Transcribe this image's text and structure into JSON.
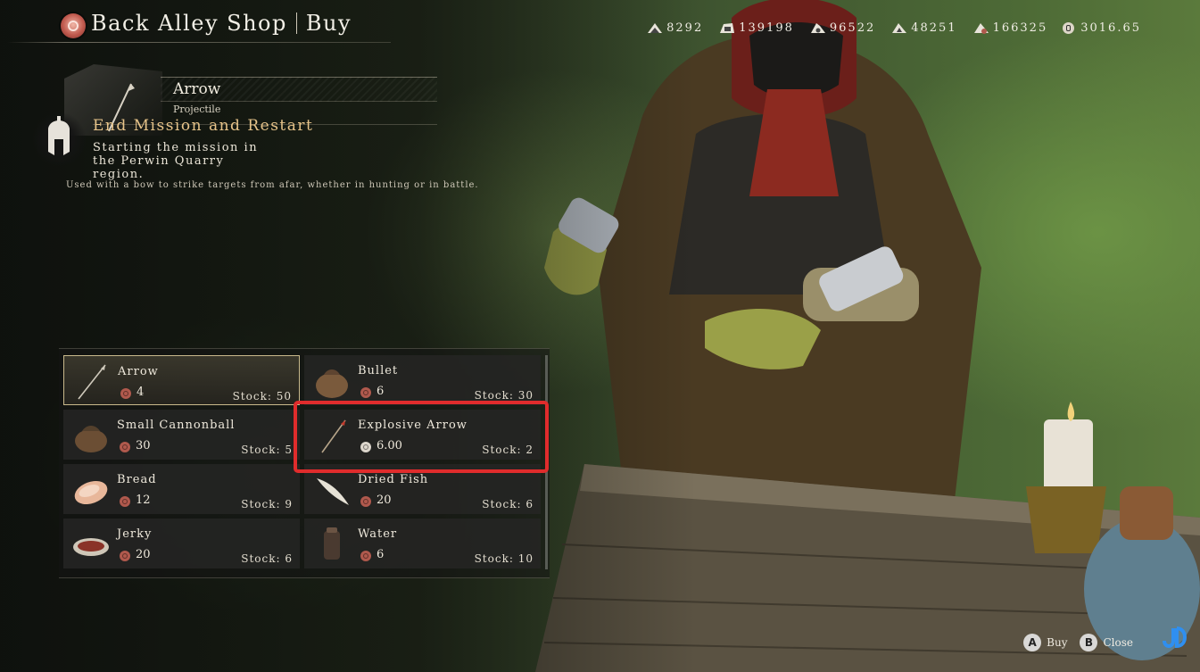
{
  "header": {
    "shop_name": "Back Alley Shop",
    "mode": "Buy"
  },
  "resources": [
    {
      "icon": "wood-resource-icon",
      "value": "8292"
    },
    {
      "icon": "iron-resource-icon",
      "value": "139198"
    },
    {
      "icon": "stone-resource-icon",
      "value": "96522"
    },
    {
      "icon": "leather-resource-icon",
      "value": "48251"
    },
    {
      "icon": "food-resource-icon",
      "value": "166325"
    },
    {
      "icon": "silver-coin-icon",
      "value": "3016.65"
    }
  ],
  "item_info": {
    "name": "Arrow",
    "category": "Projectile",
    "description": "Used with a bow to strike targets from afar, whether in hunting or in battle."
  },
  "mission": {
    "title": "End Mission and Restart",
    "description": "Starting the mission in the Perwin Quarry region."
  },
  "shop_items": [
    {
      "name": "Arrow",
      "price": "4",
      "stock_label": "Stock:",
      "stock": "50",
      "coin": "copper",
      "icon": "arrow-icon",
      "selected": true
    },
    {
      "name": "Bullet",
      "price": "6",
      "stock_label": "Stock:",
      "stock": "30",
      "coin": "copper",
      "icon": "bullet-pouch-icon",
      "selected": false
    },
    {
      "name": "Small Cannonball",
      "price": "30",
      "stock_label": "Stock:",
      "stock": "5",
      "coin": "copper",
      "icon": "cannonball-pouch-icon",
      "selected": false
    },
    {
      "name": "Explosive Arrow",
      "price": "6.00",
      "stock_label": "Stock:",
      "stock": "2",
      "coin": "silver",
      "icon": "explosive-arrow-icon",
      "selected": false
    },
    {
      "name": "Bread",
      "price": "12",
      "stock_label": "Stock:",
      "stock": "9",
      "coin": "copper",
      "icon": "bread-icon",
      "selected": false
    },
    {
      "name": "Dried Fish",
      "price": "20",
      "stock_label": "Stock:",
      "stock": "6",
      "coin": "copper",
      "icon": "dried-fish-icon",
      "selected": false
    },
    {
      "name": "Jerky",
      "price": "20",
      "stock_label": "Stock:",
      "stock": "6",
      "coin": "copper",
      "icon": "jerky-icon",
      "selected": false
    },
    {
      "name": "Water",
      "price": "6",
      "stock_label": "Stock:",
      "stock": "10",
      "coin": "copper",
      "icon": "water-flask-icon",
      "selected": false
    }
  ],
  "controls": [
    {
      "glyph": "A",
      "label": "Buy"
    },
    {
      "glyph": "B",
      "label": "Close"
    }
  ],
  "colors": {
    "highlight": "#e02c2c",
    "mission_title": "#e7c48a",
    "copper_coin": "#b0594d",
    "silver_coin": "#dcd6cc"
  }
}
